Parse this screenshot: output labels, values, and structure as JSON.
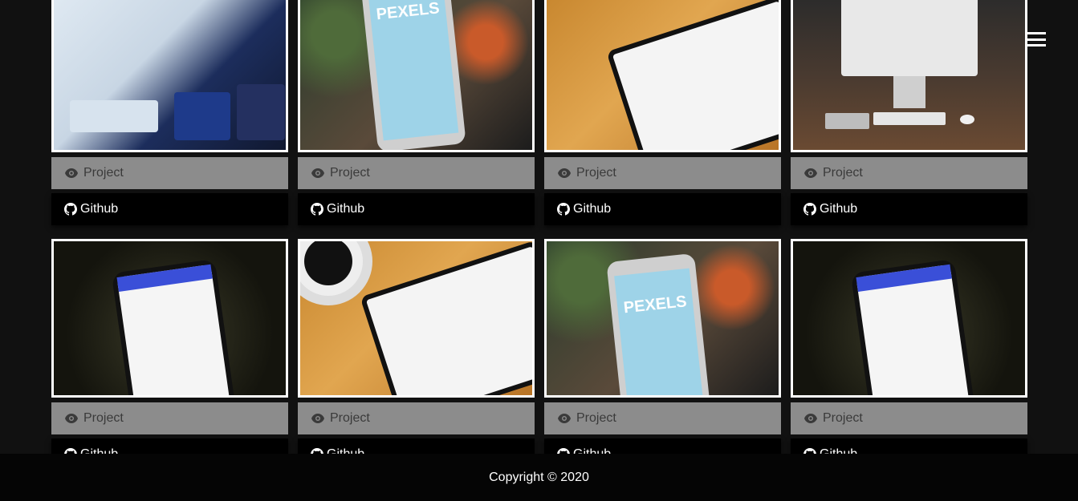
{
  "cards": [
    {
      "project_label": "Project",
      "github_label": "Github"
    },
    {
      "project_label": "Project",
      "github_label": "Github"
    },
    {
      "project_label": "Project",
      "github_label": "Github"
    },
    {
      "project_label": "Project",
      "github_label": "Github"
    },
    {
      "project_label": "Project",
      "github_label": "Github"
    },
    {
      "project_label": "Project",
      "github_label": "Github"
    },
    {
      "project_label": "Project",
      "github_label": "Github"
    },
    {
      "project_label": "Project",
      "github_label": "Github"
    }
  ],
  "phone_screen_text": "PEXELS",
  "footer": {
    "copyright": "Copyright © 2020"
  },
  "colors": {
    "background": "#111111",
    "project_button": "#8c8c8c",
    "github_button": "#000000",
    "footer": "#050505"
  },
  "icons": {
    "project": "eye-icon",
    "github": "github-icon",
    "menu": "hamburger-icon"
  }
}
